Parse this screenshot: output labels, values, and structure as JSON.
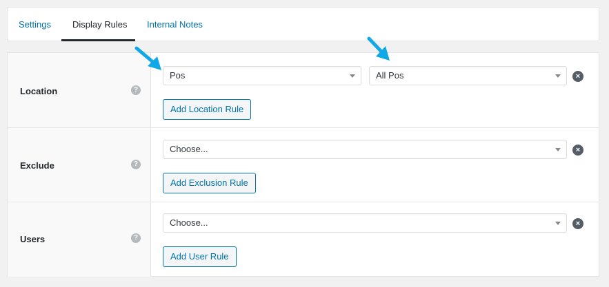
{
  "tabs": [
    {
      "label": "Settings",
      "active": false
    },
    {
      "label": "Display Rules",
      "active": true
    },
    {
      "label": "Internal Notes",
      "active": false
    }
  ],
  "rules": {
    "location": {
      "label": "Location",
      "help": "?",
      "select_type": "Pos",
      "select_value": "All Pos",
      "add_button": "Add Location Rule"
    },
    "exclude": {
      "label": "Exclude",
      "help": "?",
      "select_value": "Choose...",
      "add_button": "Add Exclusion Rule"
    },
    "users": {
      "label": "Users",
      "help": "?",
      "select_value": "Choose...",
      "add_button": "Add User Rule"
    }
  },
  "icons": {
    "remove": "×",
    "arrow_color": "#11a8e8"
  },
  "colors": {
    "link": "#0073aa",
    "active_tab_underline": "#23282d"
  }
}
